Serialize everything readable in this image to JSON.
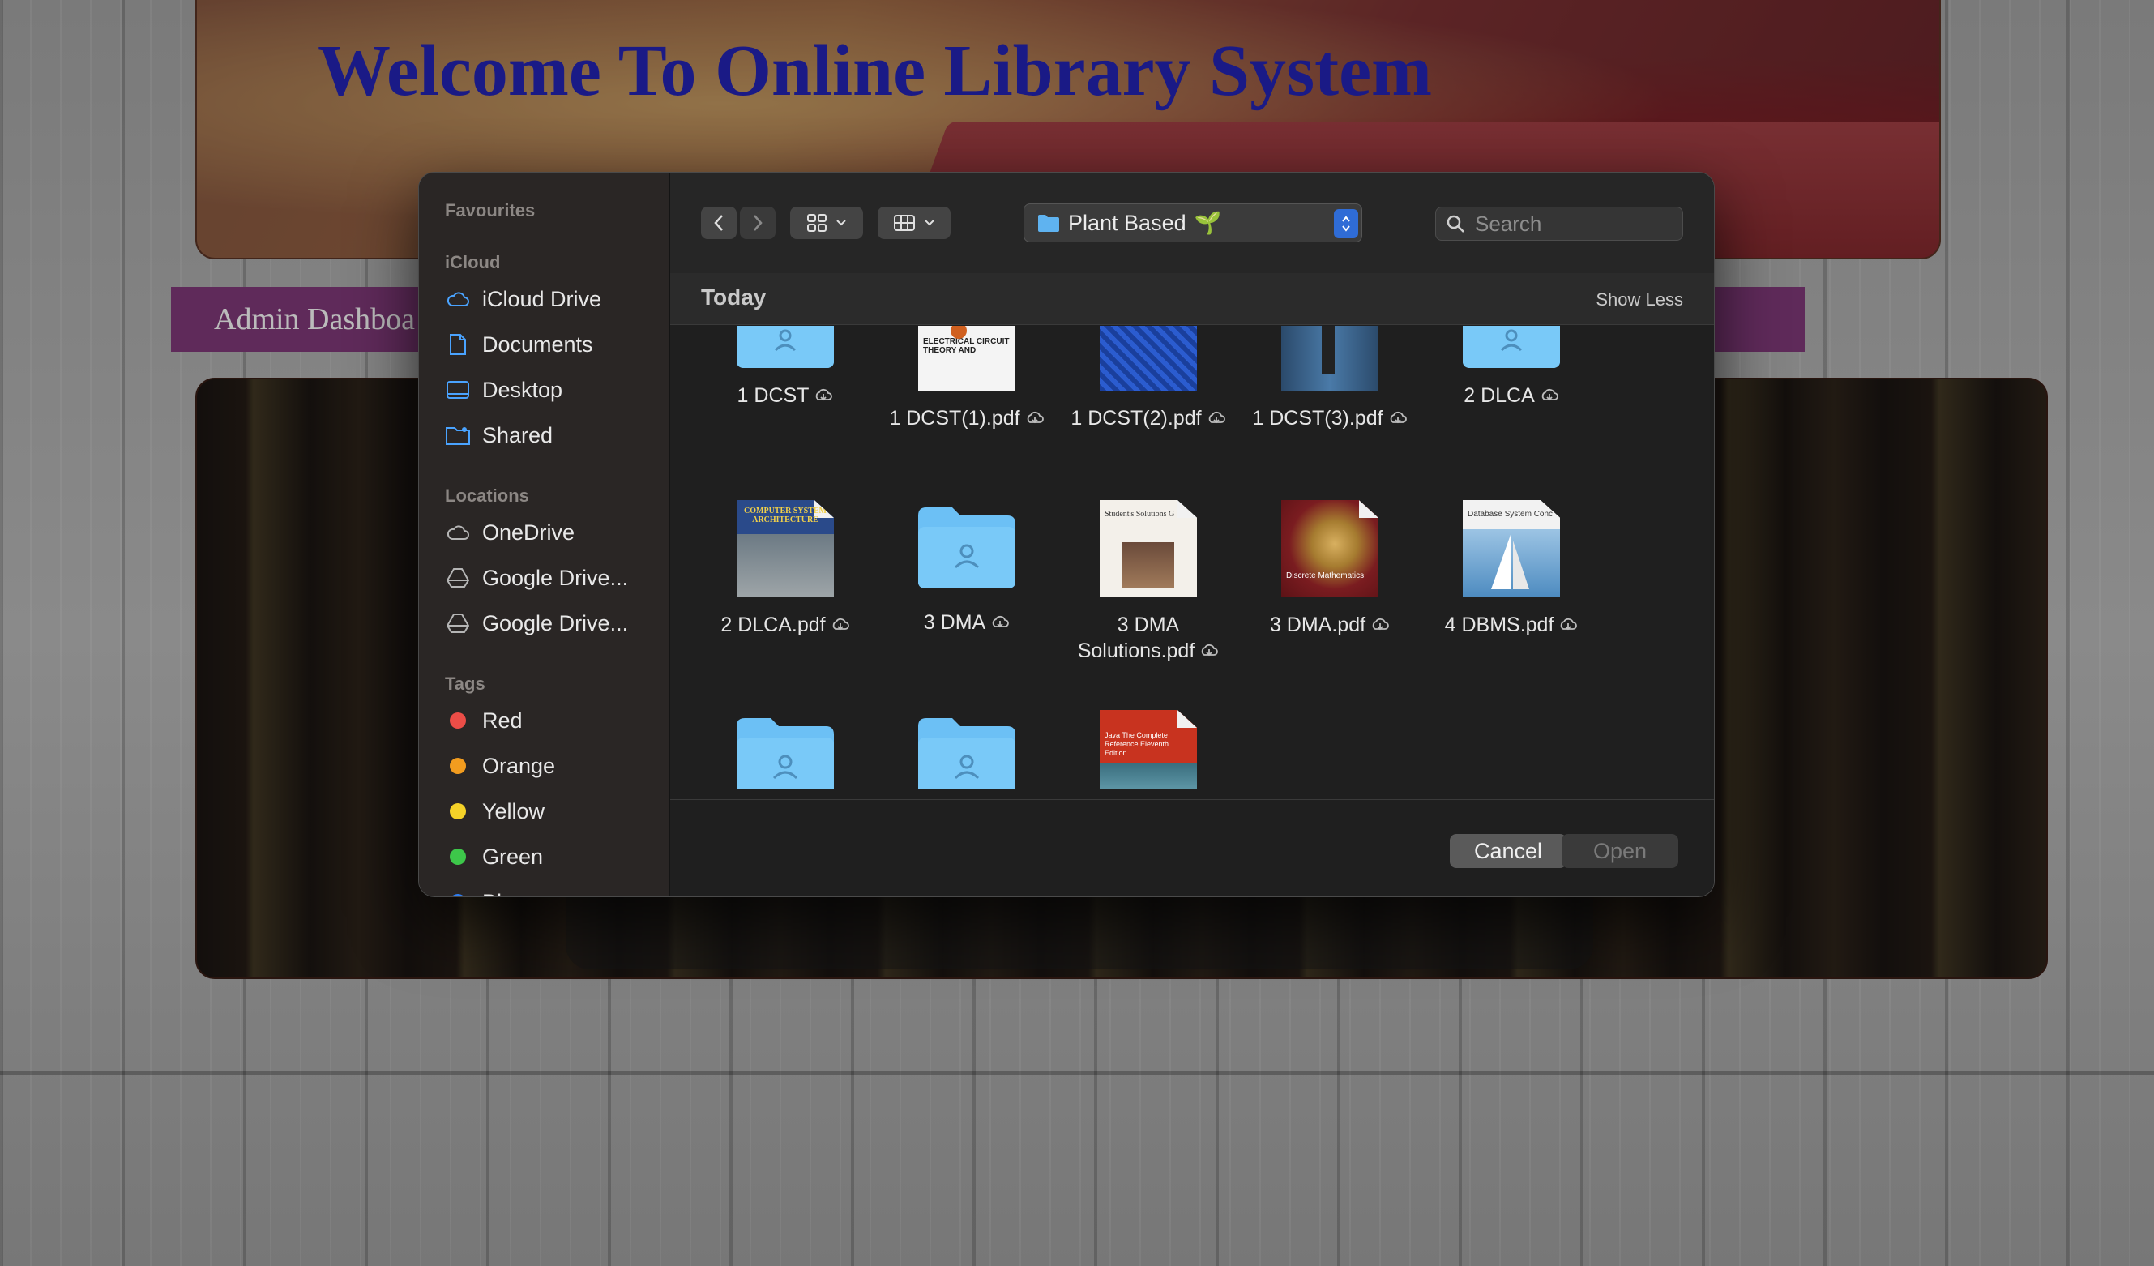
{
  "page": {
    "title": "Welcome To Online Library System",
    "admin_label": "Admin Dashboa"
  },
  "dialog": {
    "sidebar": {
      "favourites_heading": "Favourites",
      "icloud_heading": "iCloud",
      "icloud_items": [
        {
          "label": "iCloud Drive",
          "icon": "cloud-icon"
        },
        {
          "label": "Documents",
          "icon": "document-icon"
        },
        {
          "label": "Desktop",
          "icon": "desktop-icon"
        },
        {
          "label": "Shared",
          "icon": "shared-folder-icon"
        }
      ],
      "locations_heading": "Locations",
      "location_items": [
        {
          "label": "OneDrive",
          "icon": "cloud-icon"
        },
        {
          "label": "Google Drive...",
          "icon": "drive-icon"
        },
        {
          "label": "Google Drive...",
          "icon": "drive-icon"
        }
      ],
      "tags_heading": "Tags",
      "tags": [
        {
          "label": "Red",
          "color": "#eb4d47"
        },
        {
          "label": "Orange",
          "color": "#f29c1f"
        },
        {
          "label": "Yellow",
          "color": "#f5d228"
        },
        {
          "label": "Green",
          "color": "#3dc74a"
        },
        {
          "label": "Blue",
          "color": "#2f7ff5"
        }
      ]
    },
    "toolbar": {
      "back": "back",
      "forward": "forward",
      "location": "Plant Based",
      "location_emoji": "🌱",
      "search_placeholder": "Search"
    },
    "section": {
      "title": "Today",
      "toggle": "Show Less"
    },
    "files": [
      {
        "name": "1 DCST",
        "kind": "folder",
        "cloud": true
      },
      {
        "name": "1 DCST(1).pdf",
        "kind": "pdf",
        "cloud": true,
        "cover_text": "ELECTRICAL CIRCUIT THEORY AND"
      },
      {
        "name": "1 DCST(2).pdf",
        "kind": "pdf",
        "cloud": true
      },
      {
        "name": "1 DCST(3).pdf",
        "kind": "pdf",
        "cloud": true
      },
      {
        "name": "2 DLCA",
        "kind": "folder",
        "cloud": true
      },
      {
        "name": "2 DLCA.pdf",
        "kind": "pdf",
        "cloud": true,
        "cover_text": "COMPUTER SYSTEM ARCHITECTURE"
      },
      {
        "name": "3 DMA",
        "kind": "folder",
        "cloud": true
      },
      {
        "name": "3 DMA Solutions.pdf",
        "name_line1": "3 DMA",
        "name_line2": "Solutions.pdf",
        "kind": "pdf",
        "cloud": true,
        "cover_text": "Student's Solutions G"
      },
      {
        "name": "3 DMA.pdf",
        "kind": "pdf",
        "cloud": true,
        "cover_text": "Discrete Mathematics"
      },
      {
        "name": "4 DBMS.pdf",
        "kind": "pdf",
        "cloud": true,
        "cover_text": "Database System Conc"
      },
      {
        "name": "",
        "kind": "folder",
        "cloud": false
      },
      {
        "name": "",
        "kind": "folder",
        "cloud": false
      },
      {
        "name": "",
        "kind": "pdf",
        "cloud": false,
        "cover_text": "Java The Complete Reference Eleventh Edition"
      }
    ],
    "buttons": {
      "cancel": "Cancel",
      "open": "Open"
    }
  },
  "colors": {
    "title_blue": "#1a1a86",
    "folder_blue": "#6cc0f5",
    "accent_blue": "#2f6cd6"
  }
}
